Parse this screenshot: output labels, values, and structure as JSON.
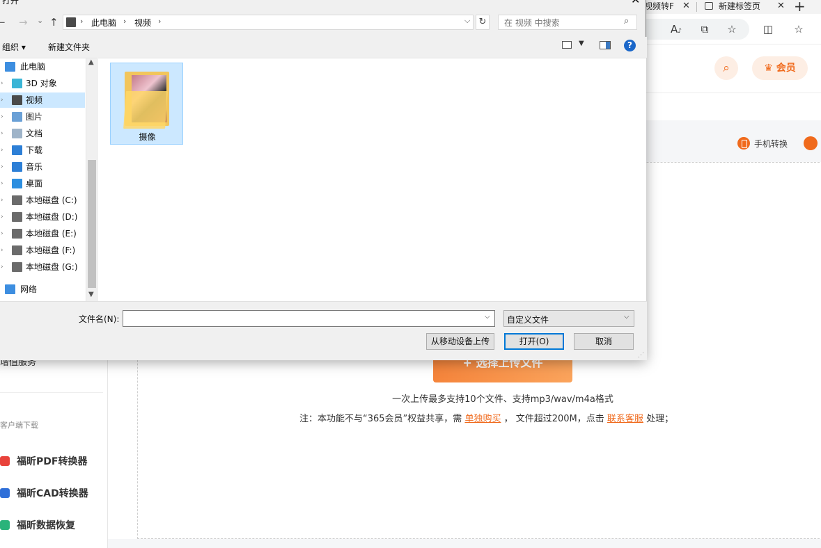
{
  "browser": {
    "tab1_title": "视频转F",
    "tab2_title": "新建标签页",
    "tab_close": "✕",
    "new_tab": "+",
    "toolbar_icons": [
      "read-aloud-icon",
      "reader-mode-icon",
      "favorite-star-icon",
      "split-screen-icon",
      "favorites-list-icon"
    ],
    "toolbar_glyphs": [
      "A͉",
      "⧉",
      "☆",
      "◫",
      "☆≡"
    ]
  },
  "site": {
    "vip_label": "会员",
    "phone_convert": "手机转换",
    "sidebar": {
      "service": "增值服务",
      "section_title": "客户端下载",
      "apps": [
        {
          "label": "福昕PDF转换器",
          "color": "#e8433b"
        },
        {
          "label": "福昕CAD转换器",
          "color": "#2f6fd8"
        },
        {
          "label": "福昕数据恢复",
          "color": "#2ab37a"
        }
      ]
    },
    "upload_button": "+ 选择上传文件",
    "note1": "一次上传最多支持10个文件、支持mp3/wav/m4a格式",
    "note2_pre": "注：本功能不与“365会员”权益共享，需",
    "note2_link1": "单独购买",
    "note2_mid": "， 文件超过200M，点击",
    "note2_link2": "联系客服",
    "note2_post": "处理；"
  },
  "dialog": {
    "title": "打开",
    "close": "✕",
    "nav": {
      "back": "←",
      "forward": "→",
      "recent": "⌄",
      "up": "↑"
    },
    "path": [
      "此电脑",
      "视频"
    ],
    "path_sep": "›",
    "refresh": "↻",
    "search_placeholder": "在 视频 中搜索",
    "organize": "组织 ▾",
    "new_folder": "新建文件夹",
    "help": "?",
    "tree": [
      {
        "label": "此电脑",
        "icon": "pc-icon",
        "color": "#3d8ee0",
        "indent": 0,
        "selected": false
      },
      {
        "label": "3D 对象",
        "icon": "3d-objects-icon",
        "color": "#3bb5d6",
        "indent": 1,
        "selected": false
      },
      {
        "label": "视频",
        "icon": "video-folder-icon",
        "color": "#4a4a4a",
        "indent": 1,
        "selected": true
      },
      {
        "label": "图片",
        "icon": "pictures-icon",
        "color": "#6aa0d6",
        "indent": 1,
        "selected": false
      },
      {
        "label": "文档",
        "icon": "documents-icon",
        "color": "#9fb4c9",
        "indent": 1,
        "selected": false
      },
      {
        "label": "下载",
        "icon": "downloads-icon",
        "color": "#2d7fd6",
        "indent": 1,
        "selected": false
      },
      {
        "label": "音乐",
        "icon": "music-icon",
        "color": "#2d7fd6",
        "indent": 1,
        "selected": false
      },
      {
        "label": "桌面",
        "icon": "desktop-icon",
        "color": "#2d8fe0",
        "indent": 1,
        "selected": false
      },
      {
        "label": "本地磁盘 (C:)",
        "icon": "drive-c-icon",
        "color": "#6b6b6b",
        "indent": 1,
        "selected": false
      },
      {
        "label": "本地磁盘 (D:)",
        "icon": "drive-d-icon",
        "color": "#6b6b6b",
        "indent": 1,
        "selected": false
      },
      {
        "label": "本地磁盘 (E:)",
        "icon": "drive-e-icon",
        "color": "#6b6b6b",
        "indent": 1,
        "selected": false
      },
      {
        "label": "本地磁盘 (F:)",
        "icon": "drive-f-icon",
        "color": "#6b6b6b",
        "indent": 1,
        "selected": false
      },
      {
        "label": "本地磁盘 (G:)",
        "icon": "drive-g-icon",
        "color": "#6b6b6b",
        "indent": 1,
        "selected": false
      },
      {
        "label": "网络",
        "icon": "network-icon",
        "color": "#3d8ee0",
        "indent": 0,
        "selected": false
      }
    ],
    "files": [
      {
        "name": "摄像",
        "type": "folder"
      }
    ],
    "filename_label": "文件名(N):",
    "filename_value": "",
    "filetype": "自定义文件",
    "btn_mobile": "从移动设备上传",
    "btn_open": "打开(O)",
    "btn_cancel": "取消"
  }
}
